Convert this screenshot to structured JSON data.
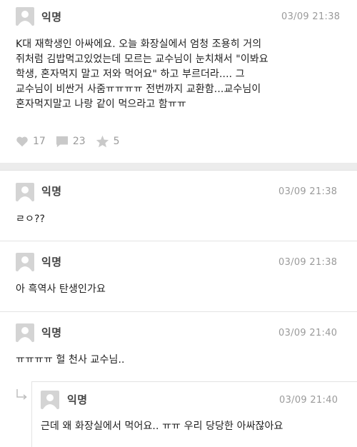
{
  "main_post": {
    "author": "익명",
    "time": "03/09 21:38",
    "lines": [
      "K대 재학생인 아싸에요. 오늘 화장실에서 엄청 조용히 거의",
      "쥐처럼 김밥먹고있었는데 모르는 교수님이 눈치채서 \"이봐요",
      "학생, 혼자먹지 말고 저와 먹어요\" 하고 부르더라.... 그",
      "교수님이 비싼거 사줌ㅠㅠㅠㅠ 전번까지 교환함...교수님이",
      "혼자먹지말고 나랑 같이 먹으라고 함ㅠㅠ"
    ],
    "likes": "17",
    "comments": "23",
    "scraps": "5"
  },
  "comments": [
    {
      "author": "익명",
      "time": "03/09 21:38",
      "text": "ㄹㅇ??"
    },
    {
      "author": "익명",
      "time": "03/09 21:38",
      "text": "아 흑역사 탄생인가요"
    },
    {
      "author": "익명",
      "time": "03/09 21:40",
      "text": "ㅠㅠㅠㅠ 헐 천사 교수님.."
    }
  ],
  "reply": {
    "author": "익명",
    "time": "03/09 21:40",
    "text": "근데 왜 화장실에서 먹어요.. ㅠㅠ 우리 당당한 아싸잖아요"
  },
  "colors": {
    "accent_gray": "#9a9a9a",
    "avatar_bg": "#d4d4d4",
    "gap_bg": "#ececec"
  }
}
